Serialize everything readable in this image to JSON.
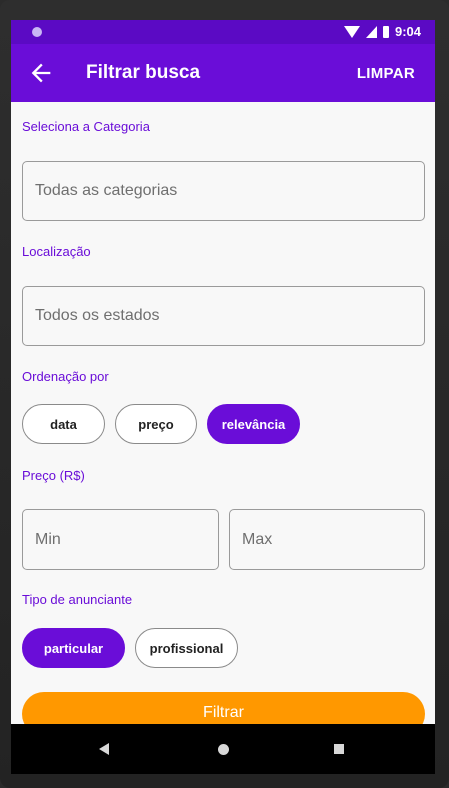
{
  "status_bar": {
    "time": "9:04"
  },
  "app_bar": {
    "title": "Filtrar busca",
    "action": "LIMPAR"
  },
  "category": {
    "label": "Seleciona a Categoria",
    "placeholder": "Todas as categorias"
  },
  "location": {
    "label": "Localização",
    "placeholder": "Todos os estados"
  },
  "sort": {
    "label": "Ordenação por",
    "options": [
      "data",
      "preço",
      "relevância"
    ],
    "selected": "relevância"
  },
  "price": {
    "label": "Preço (R$)",
    "min_placeholder": "Min",
    "max_placeholder": "Max"
  },
  "advertiser": {
    "label": "Tipo de anunciante",
    "options": [
      "particular",
      "profissional"
    ],
    "selected": "particular"
  },
  "submit": {
    "label": "Filtrar"
  },
  "colors": {
    "primary": "#6a0dd8",
    "status_bar": "#5b0ac4",
    "accent": "#ff9800"
  },
  "icons": [
    "back-arrow-icon",
    "wifi-icon",
    "signal-icon",
    "battery-icon",
    "nav-back-icon",
    "nav-home-icon",
    "nav-recent-icon"
  ]
}
